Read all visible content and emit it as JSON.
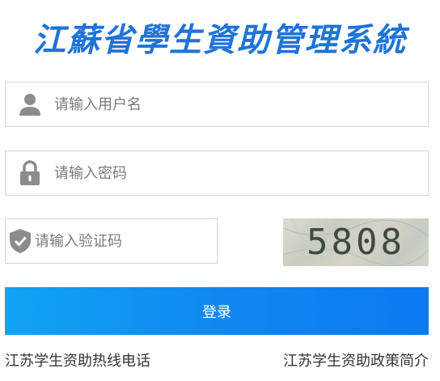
{
  "app": {
    "title": "江蘇省學生資助管理系統"
  },
  "form": {
    "username_placeholder": "请输入用户名",
    "password_placeholder": "请输入密码",
    "captcha_placeholder": "请输入验证码",
    "captcha_value": "5808",
    "login_label": "登录"
  },
  "links": {
    "hotline": "江苏学生资助热线电话",
    "policy": "江苏学生资助政策简介"
  },
  "colors": {
    "title": "#1e74d8",
    "button": "#1188f0",
    "icon": "#8c8c8c"
  }
}
